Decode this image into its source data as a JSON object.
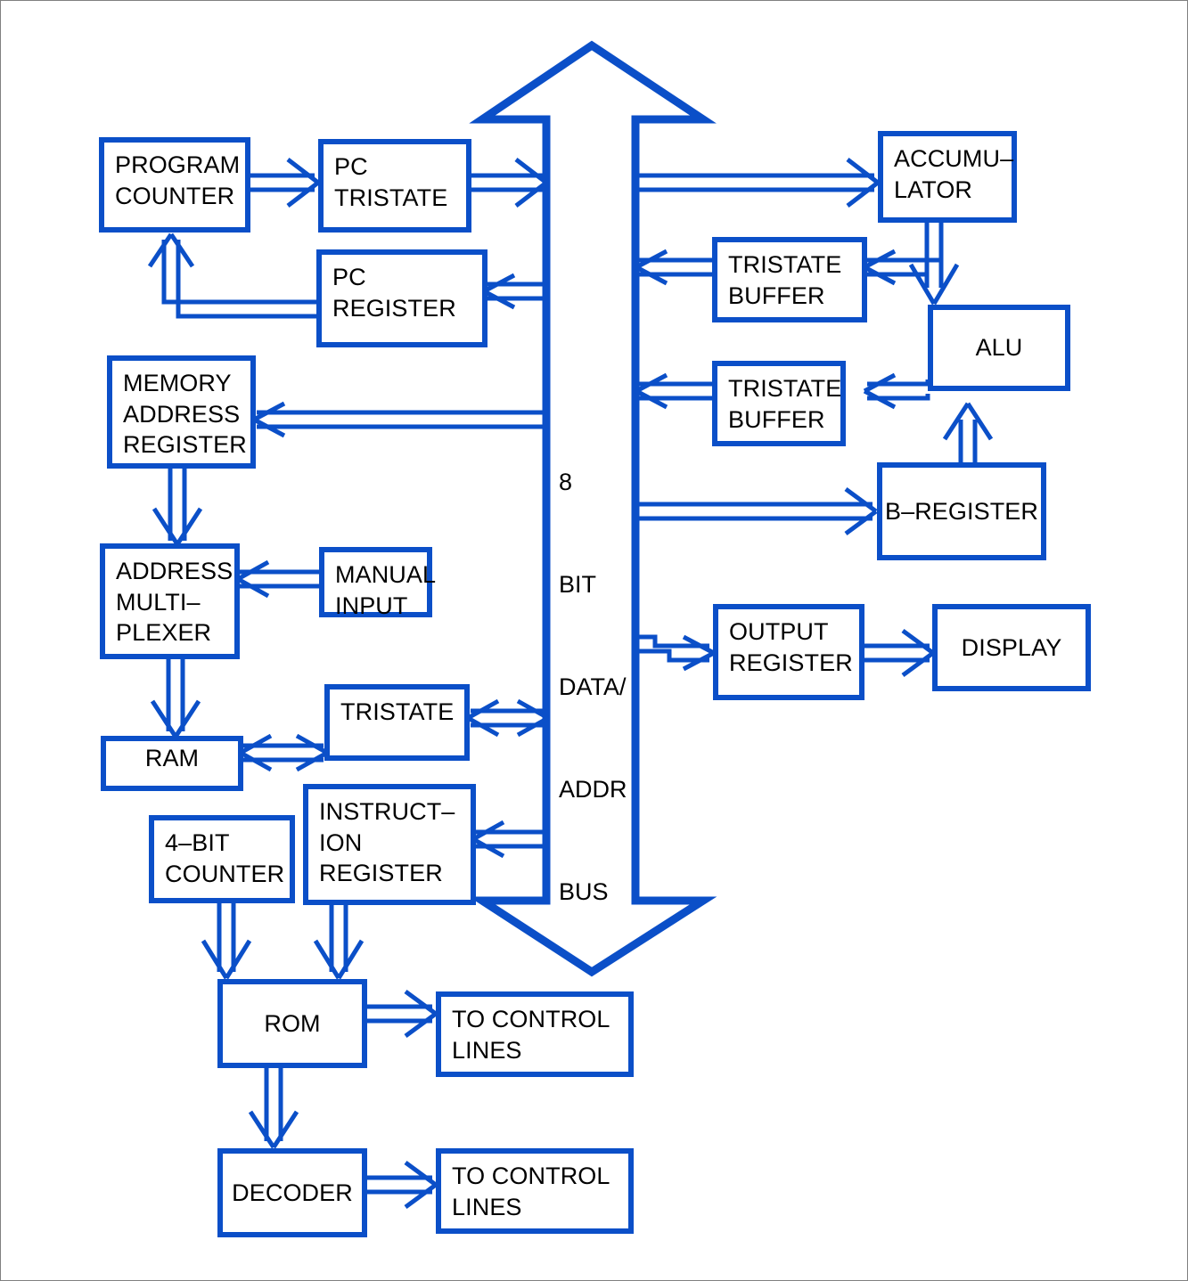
{
  "diagram": {
    "title": "8-bit computer architecture block diagram",
    "accent_color": "#0B4FC8",
    "text_color": "#000000",
    "background_color": "#ffffff",
    "border_color": "#808080"
  },
  "bus": {
    "name": "8 BIT DATA/ADDR BUS",
    "lines": [
      "8",
      "BIT",
      "DATA/",
      "ADDR",
      "BUS"
    ],
    "line_0": "8",
    "line_1": "BIT",
    "line_2": "DATA/",
    "line_3": "ADDR",
    "line_4": "BUS"
  },
  "blocks": {
    "program_counter": {
      "lines": [
        "PROGRAM",
        "COUNTER"
      ],
      "line_0": "PROGRAM",
      "line_1": "COUNTER"
    },
    "pc_tristate": {
      "lines": [
        "PC",
        "TRISTATE"
      ],
      "line_0": "PC",
      "line_1": "TRISTATE"
    },
    "pc_register": {
      "lines": [
        "PC",
        "REGISTER"
      ],
      "line_0": "PC",
      "line_1": "REGISTER"
    },
    "memory_address_register": {
      "lines": [
        "MEMORY",
        "ADDRESS",
        "REGISTER"
      ],
      "line_0": "MEMORY",
      "line_1": "ADDRESS",
      "line_2": "REGISTER"
    },
    "address_multiplexer": {
      "lines": [
        "ADDRESS",
        "MULTI–",
        "PLEXER"
      ],
      "line_0": "ADDRESS",
      "line_1": "MULTI–",
      "line_2": "PLEXER"
    },
    "manual_input": {
      "lines": [
        "MANUAL",
        "INPUT"
      ],
      "line_0": "MANUAL",
      "line_1": "INPUT"
    },
    "ram": {
      "lines": [
        "RAM"
      ],
      "line_0": "RAM"
    },
    "tristate": {
      "lines": [
        "TRISTATE"
      ],
      "line_0": "TRISTATE"
    },
    "instruction_register": {
      "lines": [
        "INSTRUCT–",
        "ION",
        "REGISTER"
      ],
      "line_0": "INSTRUCT–",
      "line_1": "ION",
      "line_2": "REGISTER"
    },
    "four_bit_counter": {
      "lines": [
        "4–BIT",
        "COUNTER"
      ],
      "line_0": "4–BIT",
      "line_1": "COUNTER"
    },
    "rom": {
      "lines": [
        "ROM"
      ],
      "line_0": "ROM"
    },
    "decoder": {
      "lines": [
        "DECODER"
      ],
      "line_0": "DECODER"
    },
    "control_lines_rom": {
      "lines": [
        "TO CONTROL",
        "LINES"
      ],
      "line_0": "TO CONTROL",
      "line_1": "LINES"
    },
    "control_lines_decoder": {
      "lines": [
        "TO CONTROL",
        "LINES"
      ],
      "line_0": "TO CONTROL",
      "line_1": "LINES"
    },
    "accumulator": {
      "lines": [
        "ACCUMU–",
        "LATOR"
      ],
      "line_0": "ACCUMU–",
      "line_1": "LATOR"
    },
    "tristate_buffer_top": {
      "lines": [
        "TRISTATE",
        "BUFFER"
      ],
      "line_0": "TRISTATE",
      "line_1": "BUFFER"
    },
    "tristate_buffer_bottom": {
      "lines": [
        "TRISTATE",
        "BUFFER"
      ],
      "line_0": "TRISTATE",
      "line_1": "BUFFER"
    },
    "alu": {
      "lines": [
        "ALU"
      ],
      "line_0": "ALU"
    },
    "b_register": {
      "lines": [
        "B–REGISTER"
      ],
      "line_0": "B–REGISTER"
    },
    "output_register": {
      "lines": [
        "OUTPUT",
        "REGISTER"
      ],
      "line_0": "OUTPUT",
      "line_1": "REGISTER"
    },
    "display": {
      "lines": [
        "DISPLAY"
      ],
      "line_0": "DISPLAY"
    }
  },
  "connections": [
    {
      "from": "program_counter",
      "to": "pc_tristate",
      "direction": "one-way"
    },
    {
      "from": "pc_tristate",
      "to": "bus",
      "direction": "one-way"
    },
    {
      "from": "bus",
      "to": "pc_register",
      "direction": "one-way"
    },
    {
      "from": "pc_register",
      "to": "program_counter",
      "direction": "one-way"
    },
    {
      "from": "bus",
      "to": "memory_address_register",
      "direction": "one-way"
    },
    {
      "from": "memory_address_register",
      "to": "address_multiplexer",
      "direction": "one-way"
    },
    {
      "from": "manual_input",
      "to": "address_multiplexer",
      "direction": "one-way"
    },
    {
      "from": "address_multiplexer",
      "to": "ram",
      "direction": "one-way"
    },
    {
      "from": "ram",
      "to": "tristate",
      "direction": "two-way"
    },
    {
      "from": "tristate",
      "to": "bus",
      "direction": "two-way"
    },
    {
      "from": "bus",
      "to": "instruction_register",
      "direction": "one-way"
    },
    {
      "from": "instruction_register",
      "to": "rom",
      "direction": "one-way"
    },
    {
      "from": "four_bit_counter",
      "to": "rom",
      "direction": "one-way"
    },
    {
      "from": "rom",
      "to": "control_lines_rom",
      "direction": "one-way"
    },
    {
      "from": "rom",
      "to": "decoder",
      "direction": "one-way"
    },
    {
      "from": "decoder",
      "to": "control_lines_decoder",
      "direction": "one-way"
    },
    {
      "from": "bus",
      "to": "accumulator",
      "direction": "one-way"
    },
    {
      "from": "accumulator",
      "to": "tristate_buffer_top",
      "direction": "one-way"
    },
    {
      "from": "tristate_buffer_top",
      "to": "bus",
      "direction": "one-way"
    },
    {
      "from": "accumulator",
      "to": "alu",
      "direction": "one-way"
    },
    {
      "from": "alu",
      "to": "tristate_buffer_bottom",
      "direction": "one-way"
    },
    {
      "from": "tristate_buffer_bottom",
      "to": "bus",
      "direction": "one-way"
    },
    {
      "from": "bus",
      "to": "b_register",
      "direction": "one-way"
    },
    {
      "from": "b_register",
      "to": "alu",
      "direction": "one-way"
    },
    {
      "from": "bus",
      "to": "output_register",
      "direction": "one-way"
    },
    {
      "from": "output_register",
      "to": "display",
      "direction": "one-way"
    }
  ]
}
